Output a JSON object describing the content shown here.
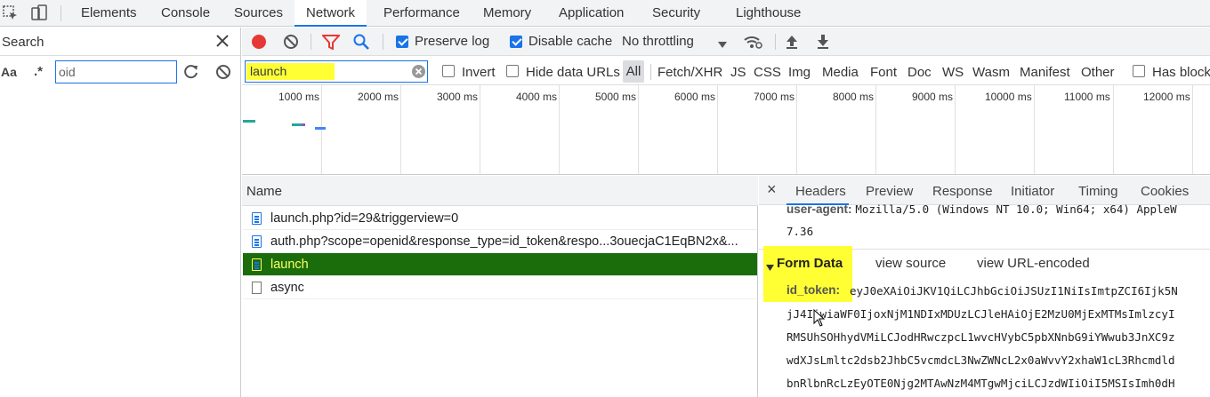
{
  "topbar": {
    "tabs": [
      "Elements",
      "Console",
      "Sources",
      "Network",
      "Performance",
      "Memory",
      "Application",
      "Security",
      "Lighthouse"
    ],
    "active": "Network"
  },
  "search": {
    "title": "Search",
    "case_label": "Aa",
    "regex_label": ".*",
    "query": "oid"
  },
  "toolbar": {
    "preserve_log": "Preserve log",
    "disable_cache": "Disable cache",
    "throttling": "No throttling",
    "preserve_checked": true,
    "disable_checked": true
  },
  "filter": {
    "value": "launch",
    "invert": "Invert",
    "hide_data_urls": "Hide data URLs",
    "types": [
      "All",
      "Fetch/XHR",
      "JS",
      "CSS",
      "Img",
      "Media",
      "Font",
      "Doc",
      "WS",
      "Wasm",
      "Manifest",
      "Other"
    ],
    "has_blocked": "Has block"
  },
  "timeline": {
    "ticks": [
      "1000 ms",
      "2000 ms",
      "3000 ms",
      "4000 ms",
      "5000 ms",
      "6000 ms",
      "7000 ms",
      "8000 ms",
      "9000 ms",
      "10000 ms",
      "11000 ms",
      "12000 ms"
    ]
  },
  "requests": {
    "header": "Name",
    "rows": [
      {
        "name": "launch.php?id=29&triggerview=0",
        "selected": false
      },
      {
        "name": "auth.php?scope=openid&response_type=id_token&respo...3ouecjaC1EqBN2x&...",
        "selected": false
      },
      {
        "name": "launch",
        "selected": true
      },
      {
        "name": "async",
        "selected": false
      }
    ]
  },
  "detail": {
    "close": "×",
    "tabs": [
      "Headers",
      "Preview",
      "Response",
      "Initiator",
      "Timing",
      "Cookies"
    ],
    "user_agent_key": "user-agent:",
    "user_agent_value": "Mozilla/5.0 (Windows NT 10.0; Win64; x64) AppleW",
    "user_agent_cont": "7.36",
    "form_data_title": "Form Data",
    "view_source": "view source",
    "view_url_encoded": "view URL-encoded",
    "id_token_key": "id_token:",
    "id_token_lines": [
      "eyJ0eXAiOiJKV1QiLCJhbGciOiJSUzI1NiIsImtpZCI6Ijk5N",
      "jJ4IiwiaWF0IjoxNjM1NDIxMDUzLCJleHAiOjE2MzU0MjExMTMsImlzcyI",
      "RMSUhSOHhydVMiLCJodHRwczpcL1wvcHVybC5pbXNnbG9iYWwub3JnXC9z",
      "wdXJsLmltc2dsb2JhbC5vcmdcL3NwZWNcL2x0aWvvY2xhaW1cL3Rhcmdld",
      "bnRlbnRcLzEyOTE0Njg2MTAwNzM4MTgwMjciLCJzdWIiOiI5MSIsImh0dH"
    ]
  },
  "colors": {
    "accent": "#1a73e8",
    "record_red": "#e53935",
    "highlight_yellow": "#ffff33",
    "selected_row": "#1b6d0c",
    "selected_text": "#ffff66"
  }
}
